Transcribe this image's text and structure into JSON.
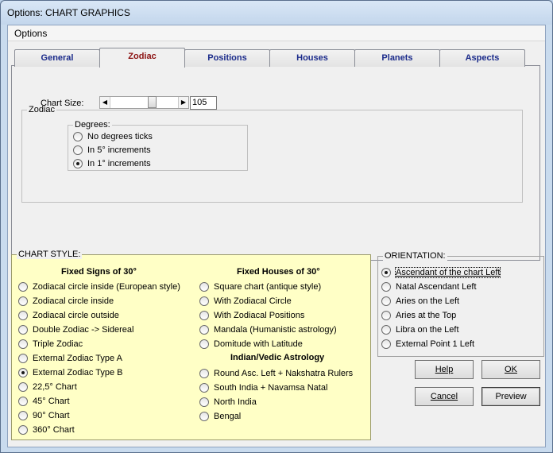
{
  "window": {
    "title": "Options: CHART GRAPHICS"
  },
  "menu": {
    "options": "Options"
  },
  "tabs": [
    {
      "label": "General",
      "active": false
    },
    {
      "label": "Zodiac",
      "active": true
    },
    {
      "label": "Positions",
      "active": false
    },
    {
      "label": "Houses",
      "active": false
    },
    {
      "label": "Planets",
      "active": false
    },
    {
      "label": "Aspects",
      "active": false
    }
  ],
  "zodiac": {
    "group_title": "Zodiac",
    "chart_size_label": "Chart Size:",
    "chart_size_value": "105",
    "degrees": {
      "title": "Degrees:",
      "options": [
        {
          "label": "No degrees ticks",
          "checked": false
        },
        {
          "label": "In 5° increments",
          "checked": false
        },
        {
          "label": "In 1° increments",
          "checked": true
        }
      ]
    }
  },
  "chart_style": {
    "title": "CHART STYLE:",
    "fixed_signs_header": "Fixed Signs of 30°",
    "fixed_houses_header": "Fixed Houses of 30°",
    "vedic_header": "Indian/Vedic Astrology",
    "left_options": [
      {
        "label": "Zodiacal circle inside (European style)",
        "checked": false
      },
      {
        "label": "Zodiacal circle inside",
        "checked": false
      },
      {
        "label": "Zodiacal circle outside",
        "checked": false
      },
      {
        "label": "Double Zodiac -> Sidereal",
        "checked": false
      },
      {
        "label": "Triple Zodiac",
        "checked": false
      },
      {
        "label": "External Zodiac Type A",
        "checked": false
      },
      {
        "label": "External Zodiac Type B",
        "checked": true
      },
      {
        "label": "22,5° Chart",
        "checked": false
      },
      {
        "label": "45° Chart",
        "checked": false
      },
      {
        "label": "90° Chart",
        "checked": false
      },
      {
        "label": "360° Chart",
        "checked": false
      }
    ],
    "houses_options": [
      {
        "label": "Square chart (antique style)",
        "checked": false
      },
      {
        "label": "With Zodiacal Circle",
        "checked": false
      },
      {
        "label": "With Zodiacal Positions",
        "checked": false
      },
      {
        "label": "Mandala (Humanistic astrology)",
        "checked": false
      },
      {
        "label": "Domitude with Latitude",
        "checked": false
      }
    ],
    "vedic_options": [
      {
        "label": "Round Asc. Left + Nakshatra Rulers",
        "checked": false
      },
      {
        "label": "South India + Navamsa Natal",
        "checked": false
      },
      {
        "label": "North India",
        "checked": false
      },
      {
        "label": "Bengal",
        "checked": false
      }
    ]
  },
  "orientation": {
    "title": "ORIENTATION:",
    "options": [
      {
        "label": "Ascendant of the chart Left",
        "checked": true
      },
      {
        "label": "Natal Ascendant Left",
        "checked": false
      },
      {
        "label": "Aries on the Left",
        "checked": false
      },
      {
        "label": "Aries at the Top",
        "checked": false
      },
      {
        "label": "Libra on the Left",
        "checked": false
      },
      {
        "label": "External Point 1 Left",
        "checked": false
      }
    ]
  },
  "buttons": {
    "help": "Help",
    "ok": "OK",
    "cancel": "Cancel",
    "preview": "Preview"
  }
}
